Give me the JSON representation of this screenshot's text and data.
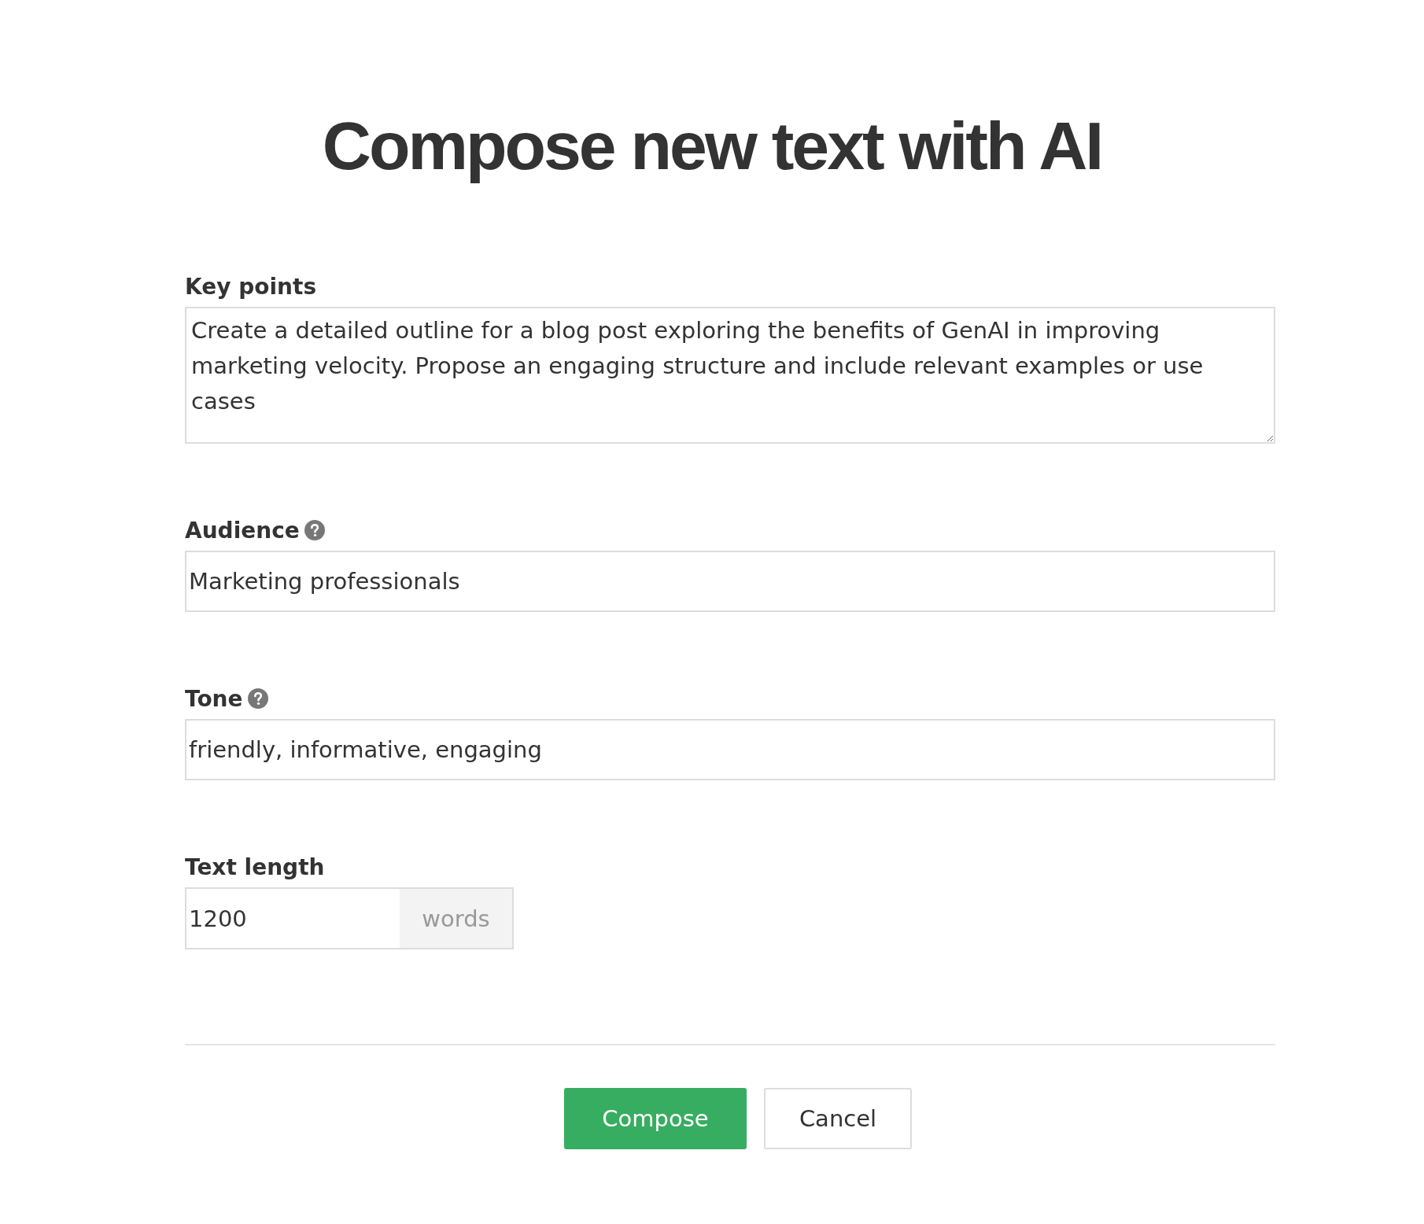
{
  "title": "Compose new text with AI",
  "fields": [
    {
      "kind": "textarea",
      "label": "Key points",
      "help": false,
      "value": "Create a detailed outline for a blog post exploring the benefits of GenAI in improving marketing velocity. Propose an engaging structure and include relevant examples or use cases"
    },
    {
      "kind": "input",
      "label": "Audience",
      "help": true,
      "value": "Marketing professionals"
    },
    {
      "kind": "input",
      "label": "Tone",
      "help": true,
      "value": "friendly, informative, engaging"
    },
    {
      "kind": "suffixed",
      "label": "Text length",
      "help": false,
      "value": "1200",
      "suffix": "words"
    }
  ],
  "buttons": [
    {
      "label": "Compose",
      "kind": "primary"
    },
    {
      "label": "Cancel",
      "kind": "secondary"
    }
  ]
}
